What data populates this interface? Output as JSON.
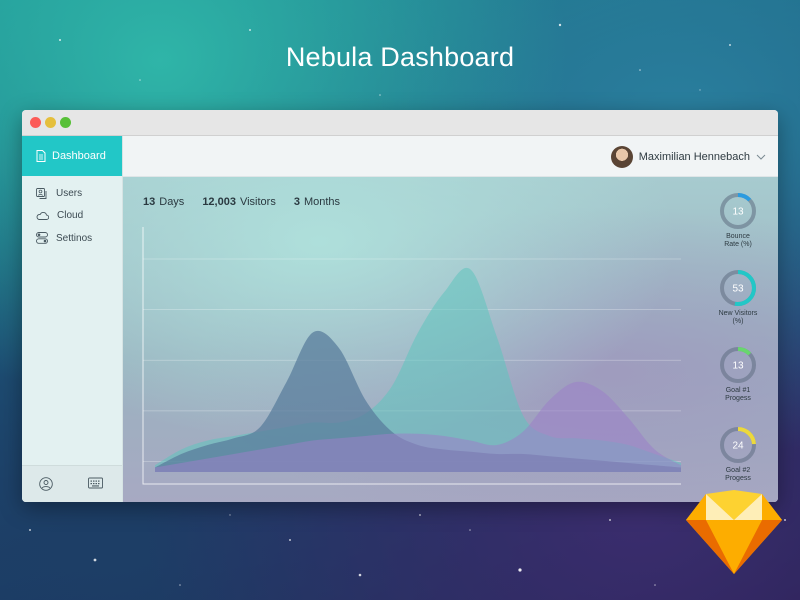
{
  "page": {
    "title": "Nebula Dashboard"
  },
  "sidebar": {
    "active": {
      "label": "Dashboard",
      "icon": "document-icon"
    },
    "items": [
      {
        "label": "Users",
        "icon": "users-icon"
      },
      {
        "label": "Cloud",
        "icon": "cloud-icon"
      },
      {
        "label": "Settinos",
        "icon": "toggles-icon"
      }
    ],
    "bottom_icons": [
      "user-circle-icon",
      "keyboard-icon"
    ]
  },
  "header": {
    "user_name": "Maximilian Hennebach"
  },
  "stats": [
    {
      "value": "13",
      "label": "Days"
    },
    {
      "value": "12,003",
      "label": "Visitors"
    },
    {
      "value": "3",
      "label": "Months"
    }
  ],
  "rings": [
    {
      "value": "13",
      "percent": 13,
      "label_line1": "Bounce",
      "label_line2": "Rate (%)",
      "color": "#2b9be0"
    },
    {
      "value": "53",
      "percent": 53,
      "label_line1": "New Visitors",
      "label_line2": "(%)",
      "color": "#22c7c7"
    },
    {
      "value": "13",
      "percent": 13,
      "label_line1": "Goal #1",
      "label_line2": "Progess",
      "color": "#68d66e"
    },
    {
      "value": "24",
      "percent": 24,
      "label_line1": "Goal #2",
      "label_line2": "Progess",
      "color": "#ecd93c"
    }
  ],
  "colors": {
    "accent": "#22c7c7",
    "series_teal": "#5fc4bd",
    "series_blue": "#5a7e9c",
    "series_purple": "#9a80c8"
  },
  "chart_data": {
    "type": "area",
    "x": [
      0,
      1,
      2,
      3,
      4,
      5,
      6,
      7,
      8,
      9,
      10,
      11,
      12,
      13,
      14,
      15,
      16,
      17,
      18,
      19,
      20
    ],
    "ylim": [
      0,
      100
    ],
    "grid": true,
    "series": [
      {
        "values": [
          2,
          8,
          12,
          15,
          20,
          40,
          62,
          55,
          32,
          18,
          12,
          10,
          9,
          8,
          8,
          7,
          6,
          5,
          4,
          3,
          2
        ]
      },
      {
        "values": [
          3,
          10,
          14,
          16,
          18,
          20,
          22,
          22,
          26,
          38,
          62,
          80,
          90,
          60,
          25,
          16,
          15,
          14,
          12,
          8,
          4
        ]
      },
      {
        "values": [
          2,
          4,
          6,
          8,
          10,
          12,
          14,
          15,
          16,
          17,
          17,
          16,
          14,
          12,
          18,
          32,
          40,
          36,
          24,
          10,
          3
        ]
      }
    ]
  }
}
